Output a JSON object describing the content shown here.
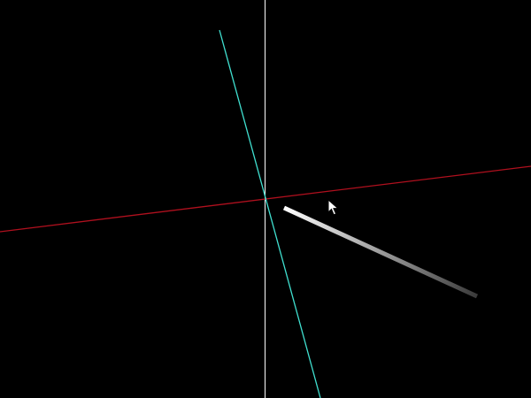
{
  "viewport": {
    "background_color": "#000000"
  },
  "axes": {
    "vertical_guide": {
      "color": "#ffffff"
    },
    "x_axis": {
      "color": "#b0101e"
    },
    "y_axis": {
      "color": "#40e0d0"
    }
  },
  "segment": {
    "start_color": "#ffffff",
    "end_color": "#3a3a3a"
  },
  "cursor": {
    "icon": "arrow-pointer-icon",
    "fill_color": "#ffffff",
    "stroke_color": "#000000"
  }
}
